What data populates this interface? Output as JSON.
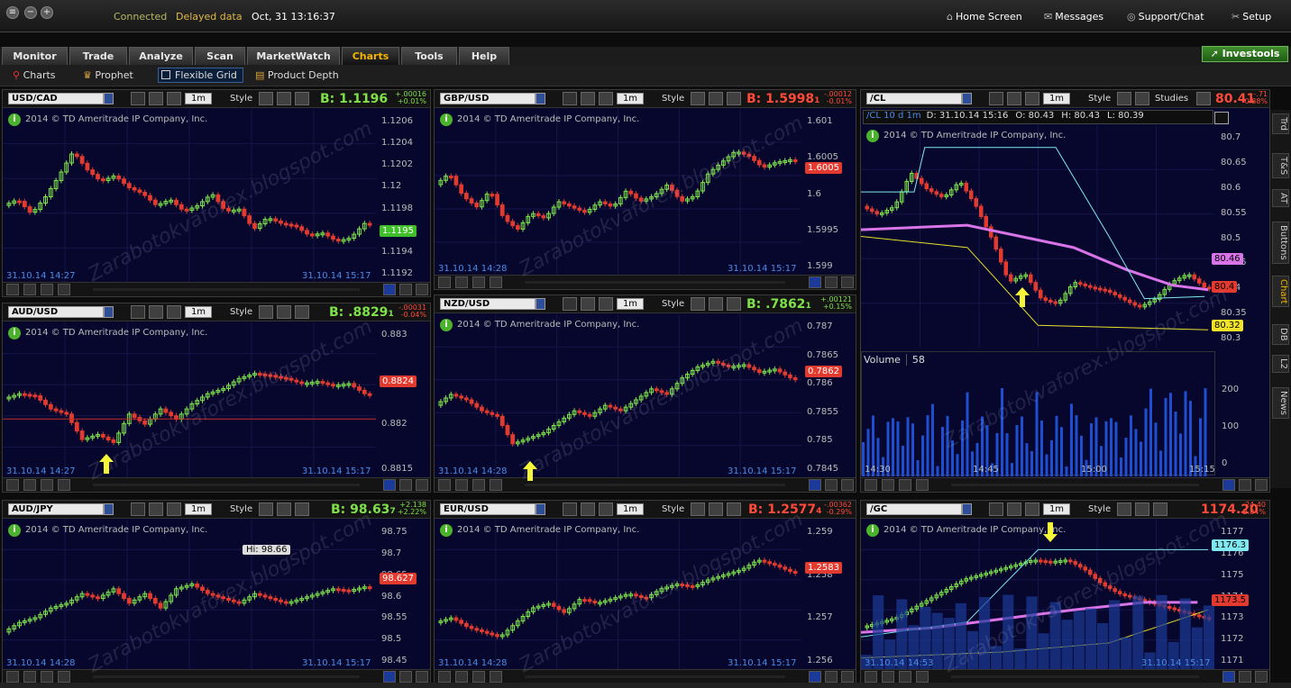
{
  "topbar": {
    "connection": "Connected",
    "data_status": "Delayed data",
    "clock": "Oct, 31  13:16:37",
    "nav": [
      {
        "label": "Home Screen",
        "icon": "home-icon"
      },
      {
        "label": "Messages",
        "icon": "messages-icon"
      },
      {
        "label": "Support/Chat",
        "icon": "support-icon"
      },
      {
        "label": "Setup",
        "icon": "setup-icon"
      }
    ]
  },
  "tabs": [
    "Monitor",
    "Trade",
    "Analyze",
    "Scan",
    "MarketWatch",
    "Charts",
    "Tools",
    "Help"
  ],
  "active_tab": "Charts",
  "investools": "Investools",
  "subtabs": [
    {
      "label": "Charts",
      "icon": "charts-icon"
    },
    {
      "label": "Prophet",
      "icon": "prophet-icon"
    },
    {
      "label": "Flexible Grid",
      "icon": "flexible-grid-icon"
    },
    {
      "label": "Product Depth",
      "icon": "product-depth-icon"
    }
  ],
  "common": {
    "copyright": "2014 © TD Ameritrade IP Company, Inc.",
    "style_label": "Style",
    "timeframe": "1m",
    "studies_label": "Studies",
    "info": "i"
  },
  "watermark": "Zarabotokvaforex.blogspot.com",
  "panels": [
    {
      "id": "usdcad",
      "symbol": "USD/CAD",
      "bid": "B: 1.1196",
      "chg1": "+.00016",
      "chg2": "+0.01%",
      "bid_color": "#7ee04a",
      "chg_color": "#7ee04a",
      "yticks": [
        "1.1206",
        "1.1204",
        "1.1202",
        "1.12",
        "1.1198",
        "1.1196",
        "1.1194",
        "1.1192"
      ],
      "price_tag": "1.1195",
      "tag_color": "#3fbf2a",
      "time_left": "31.10.14 14:27",
      "time_right": "31.10.14 15:17"
    },
    {
      "id": "gbpusd",
      "symbol": "GBP/USD",
      "bid": "B: 1.5998",
      "bid_sub": "1",
      "chg1": "-.00012",
      "chg2": "-0.01%",
      "bid_color": "#ff4a3a",
      "chg_color": "#ff4a3a",
      "yticks": [
        "1.601",
        "1.6005",
        "1.6",
        "1.5995",
        "1.599"
      ],
      "price_tag": "1.6005",
      "tag_color": "#e33a2f",
      "time_left": "31.10.14 14:28",
      "time_right": "31.10.14 15:17"
    },
    {
      "id": "cl",
      "symbol": "/CL",
      "bid": "80.41",
      "chg1": "-.71",
      "chg2": "-0.88%",
      "bid_color": "#ff4a3a",
      "chg_color": "#ff4a3a",
      "info_bar": {
        "study": "/CL 10 d 1m",
        "date": "D: 31.10.14 15:16",
        "open": "O: 80.43",
        "high": "H: 80.43",
        "low": "L: 80.39"
      },
      "yticks": [
        "80.7",
        "80.65",
        "80.6",
        "80.55",
        "80.5",
        "80.45",
        "80.4",
        "80.35",
        "80.3"
      ],
      "tags": [
        {
          "v": "80.46",
          "c": "#d874e8"
        },
        {
          "v": "80.4",
          "c": "#e33a2f"
        },
        {
          "v": "80.32",
          "c": "#f2e32a"
        }
      ],
      "volume_label": "Volume",
      "volume_value": "58",
      "vticks": [
        "200",
        "100",
        "0"
      ],
      "xticks": [
        "14:30",
        "14:45",
        "15:00",
        "15:15"
      ]
    },
    {
      "id": "audusd",
      "symbol": "AUD/USD",
      "bid": "B: .8829",
      "bid_sub": "1",
      "chg1": "-.00031",
      "chg2": "-0.04%",
      "bid_color": "#7ee04a",
      "chg_color": "#ff4a3a",
      "yticks": [
        "0.883",
        "0.8825",
        "0.882",
        "0.8815"
      ],
      "price_tag": "0.8824",
      "tag_color": "#e33a2f",
      "time_left": "31.10.14 14:27",
      "time_right": "31.10.14 15:17"
    },
    {
      "id": "nzdusd",
      "symbol": "NZD/USD",
      "bid": "B: .7862",
      "bid_sub": "1",
      "chg1": "+.00121",
      "chg2": "+0.15%",
      "bid_color": "#7ee04a",
      "chg_color": "#7ee04a",
      "yticks": [
        "0.787",
        "0.7865",
        "0.786",
        "0.7855",
        "0.785",
        "0.7845"
      ],
      "price_tag": "0.7862",
      "tag_color": "#e33a2f",
      "time_left": "31.10.14 14:28",
      "time_right": "31.10.14 15:17"
    },
    {
      "id": "audjpy",
      "symbol": "AUD/JPY",
      "bid": "B: 98.63",
      "bid_sub": "7",
      "chg1": "+2.138",
      "chg2": "+2.22%",
      "bid_color": "#7ee04a",
      "chg_color": "#7ee04a",
      "yticks": [
        "98.75",
        "98.7",
        "98.65",
        "98.6",
        "98.55",
        "98.5",
        "98.45"
      ],
      "price_tag": "98.627",
      "tag_color": "#e33a2f",
      "hi": "Hi: 98.66",
      "time_left": "31.10.14 14:28",
      "time_right": "31.10.14 15:17"
    },
    {
      "id": "eurusd",
      "symbol": "EUR/USD",
      "bid": "B: 1.2577",
      "bid_sub": "4",
      "chg1": "-.00362",
      "chg2": "-0.29%",
      "bid_color": "#ff4a3a",
      "chg_color": "#ff4a3a",
      "yticks": [
        "1.259",
        "1.258",
        "1.257",
        "1.256"
      ],
      "price_tag": "1.2583",
      "tag_color": "#e33a2f",
      "time_left": "31.10.14 14:28",
      "time_right": "31.10.14 15:17"
    },
    {
      "id": "gc",
      "symbol": "/GC",
      "bid": "1174.20",
      "chg1": "-24.40",
      "chg2": "-2.04%",
      "bid_color": "#ff4a3a",
      "chg_color": "#ff4a3a",
      "yticks": [
        "1177",
        "1176",
        "1175",
        "1174",
        "1173",
        "1172",
        "1171"
      ],
      "tags": [
        {
          "v": "1176.3",
          "c": "#7fe8f0"
        },
        {
          "v": "1173.5",
          "c": "#e33a2f"
        }
      ],
      "time_left": "31.10.14 14:53",
      "time_right": "31.10.14 15:17"
    }
  ],
  "right_tabs": [
    "Trd",
    "T&S",
    "AT",
    "Buttons",
    "Chart",
    "DB",
    "L2",
    "News"
  ],
  "right_active": "Chart"
}
